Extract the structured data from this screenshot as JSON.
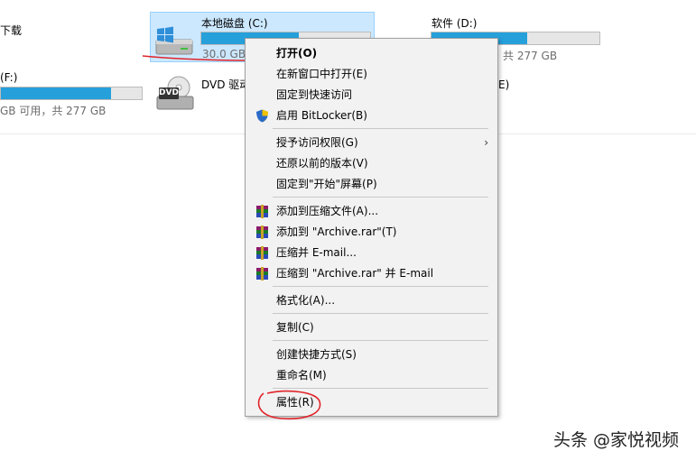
{
  "quick_access_partial": "下载",
  "drives": {
    "c": {
      "name": "本地磁盘 (C:)",
      "free": "30.0 GB",
      "used_fraction": 0.58
    },
    "d": {
      "name": "软件 (D:)",
      "stat": "共 277 GB",
      "used_fraction": 0.57
    },
    "f": {
      "name": "(F:)",
      "stat": "GB 可用，共 277 GB",
      "used_fraction": 0.78
    },
    "dvd": {
      "name": "DVD 驱动",
      "icon_label": "DVD",
      "partial_right": "E)"
    }
  },
  "context_menu": {
    "items": [
      {
        "id": "open",
        "label": "打开(O)",
        "bold": true
      },
      {
        "id": "open-new-window",
        "label": "在新窗口中打开(E)"
      },
      {
        "id": "pin-quick-access",
        "label": "固定到快速访问"
      },
      {
        "id": "enable-bitlocker",
        "label": "启用 BitLocker(B)",
        "icon": "shield-icon"
      },
      {
        "id": "grant-access",
        "label": "授予访问权限(G)",
        "submenu": true
      },
      {
        "id": "restore-versions",
        "label": "还原以前的版本(V)"
      },
      {
        "id": "pin-start",
        "label": "固定到\"开始\"屏幕(P)"
      },
      {
        "id": "add-archive",
        "label": "添加到压缩文件(A)...",
        "icon": "winrar-icon"
      },
      {
        "id": "add-archive-rar",
        "label": "添加到 \"Archive.rar\"(T)",
        "icon": "winrar-icon"
      },
      {
        "id": "compress-email",
        "label": "压缩并 E-mail...",
        "icon": "winrar-icon"
      },
      {
        "id": "compress-rar-email",
        "label": "压缩到 \"Archive.rar\" 并 E-mail",
        "icon": "winrar-icon"
      },
      {
        "id": "format",
        "label": "格式化(A)..."
      },
      {
        "id": "copy",
        "label": "复制(C)"
      },
      {
        "id": "create-shortcut",
        "label": "创建快捷方式(S)"
      },
      {
        "id": "rename",
        "label": "重命名(M)"
      },
      {
        "id": "properties",
        "label": "属性(R)"
      }
    ],
    "submenu_arrow": "›"
  },
  "watermark": "头条 @家悦视频",
  "colors": {
    "accent": "#26a0da",
    "selection": "#cce8ff",
    "annotation": "#e0242a"
  }
}
